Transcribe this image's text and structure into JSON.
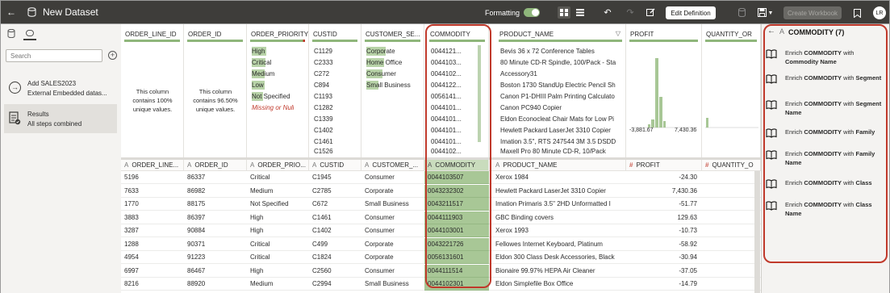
{
  "topbar": {
    "title": "New Dataset",
    "formatting_label": "Formatting",
    "edit_definition_label": "Edit Definition",
    "create_workbook_label": "Create Workbook",
    "avatar_initials": "LR"
  },
  "leftpanel": {
    "search_placeholder": "Search",
    "steps": [
      {
        "title": "Add SALES2023",
        "subtitle": "External Embedded datas..."
      },
      {
        "title": "Results",
        "subtitle": "All steps combined"
      }
    ]
  },
  "profiles": {
    "order_line_id": {
      "header": "ORDER_LINE_ID",
      "summary": [
        "This column",
        "contains 100%",
        "unique values."
      ]
    },
    "order_id": {
      "header": "ORDER_ID",
      "summary": [
        "This column",
        "contains 96.50%",
        "unique values."
      ]
    },
    "order_priority": {
      "header": "ORDER_PRIORITY",
      "values": [
        "High",
        "Critical",
        "Medium",
        "Low",
        "Not Specified"
      ],
      "missing": "Missing or Null"
    },
    "custid": {
      "header": "CUSTID",
      "values": [
        "C1129",
        "C2333",
        "C272",
        "C894",
        "C1193",
        "C1282",
        "C1339",
        "C1402",
        "C1461",
        "C1526"
      ]
    },
    "customer_segment": {
      "header": "CUSTOMER_SE...",
      "values": [
        "Corporate",
        "Home Office",
        "Consumer",
        "Small Business"
      ]
    },
    "commodity": {
      "header": "COMMODITY",
      "values": [
        "0044121...",
        "0044103...",
        "0044102...",
        "0044122...",
        "0056141...",
        "0044101...",
        "0044101...",
        "0044101...",
        "0044101...",
        "0044102..."
      ]
    },
    "product_name": {
      "header": "PRODUCT_NAME",
      "values": [
        "Bevis 36 x 72 Conference Tables",
        "80 Minute CD-R Spindle, 100/Pack - Sta",
        "Accessory31",
        "Boston 1730 StandUp Electric Pencil Sh",
        "Canon P1-DHIII Palm Printing Calculato",
        "Canon PC940 Copier",
        "Eldon Econocleat Chair Mats for Low Pi",
        "Hewlett Packard LaserJet 3310 Copier",
        "Imation 3.5\", RTS 247544 3M 3.5 DSDD",
        "Maxell Pro 80 Minute CD-R, 10/Pack"
      ]
    },
    "profit": {
      "header": "PROFIT",
      "min": "-3,881.67",
      "max": "7,430.36"
    },
    "quantity": {
      "header": "QUANTITY_OR"
    }
  },
  "columns": [
    "ORDER_LINE...",
    "ORDER_ID",
    "ORDER_PRIO...",
    "CUSTID",
    "CUSTOMER_...",
    "COMMODITY",
    "PRODUCT_NAME",
    "PROFIT",
    "QUANTITY_O"
  ],
  "rows": [
    [
      "5196",
      "86337",
      "Critical",
      "C1945",
      "Consumer",
      "0044103507",
      "Xerox 1984",
      "-24.30"
    ],
    [
      "7633",
      "86982",
      "Medium",
      "C2785",
      "Corporate",
      "0043232302",
      "Hewlett Packard LaserJet 3310 Copier",
      "7,430.36"
    ],
    [
      "1770",
      "88175",
      "Not Specified",
      "C672",
      "Small Business",
      "0043211517",
      "Imation Primaris 3.5\" 2HD Unformatted I",
      "-51.77"
    ],
    [
      "3883",
      "86397",
      "High",
      "C1461",
      "Consumer",
      "0044111903",
      "GBC Binding covers",
      "129.63"
    ],
    [
      "3287",
      "90884",
      "High",
      "C1402",
      "Consumer",
      "0044103001",
      "Xerox 1993",
      "-10.73"
    ],
    [
      "1288",
      "90371",
      "Critical",
      "C499",
      "Corporate",
      "0043221726",
      "Fellowes Internet Keyboard, Platinum",
      "-58.92"
    ],
    [
      "4954",
      "91223",
      "Critical",
      "C1824",
      "Corporate",
      "0056131601",
      "Eldon 300 Class Desk Accessories, Black",
      "-30.94"
    ],
    [
      "6997",
      "86467",
      "High",
      "C2560",
      "Consumer",
      "0044111514",
      "Bionaire 99.97% HEPA Air Cleaner",
      "-37.05"
    ],
    [
      "8216",
      "88920",
      "Medium",
      "C2994",
      "Small Business",
      "0044102301",
      "Eldon Simplefile Box Office",
      "-14.79"
    ]
  ],
  "rightpanel": {
    "title": "COMMODITY (7)",
    "items": [
      {
        "prefix": "Enrich ",
        "col": "COMMODITY",
        "mid": " with ",
        "target": "Commodity Name"
      },
      {
        "prefix": "Enrich ",
        "col": "COMMODITY",
        "mid": " with ",
        "target": "Segment"
      },
      {
        "prefix": "Enrich ",
        "col": "COMMODITY",
        "mid": " with ",
        "target": "Segment Name"
      },
      {
        "prefix": "Enrich ",
        "col": "COMMODITY",
        "mid": " with ",
        "target": "Family"
      },
      {
        "prefix": "Enrich ",
        "col": "COMMODITY",
        "mid": " with ",
        "target": "Family Name"
      },
      {
        "prefix": "Enrich ",
        "col": "COMMODITY",
        "mid": " with ",
        "target": "Class"
      },
      {
        "prefix": "Enrich ",
        "col": "COMMODITY",
        "mid": " with ",
        "target": "Class Name"
      }
    ]
  },
  "colors": {
    "accent_green": "#8fb67b",
    "highlight_red": "#c0392b",
    "topbar": "#3e3d3a"
  }
}
